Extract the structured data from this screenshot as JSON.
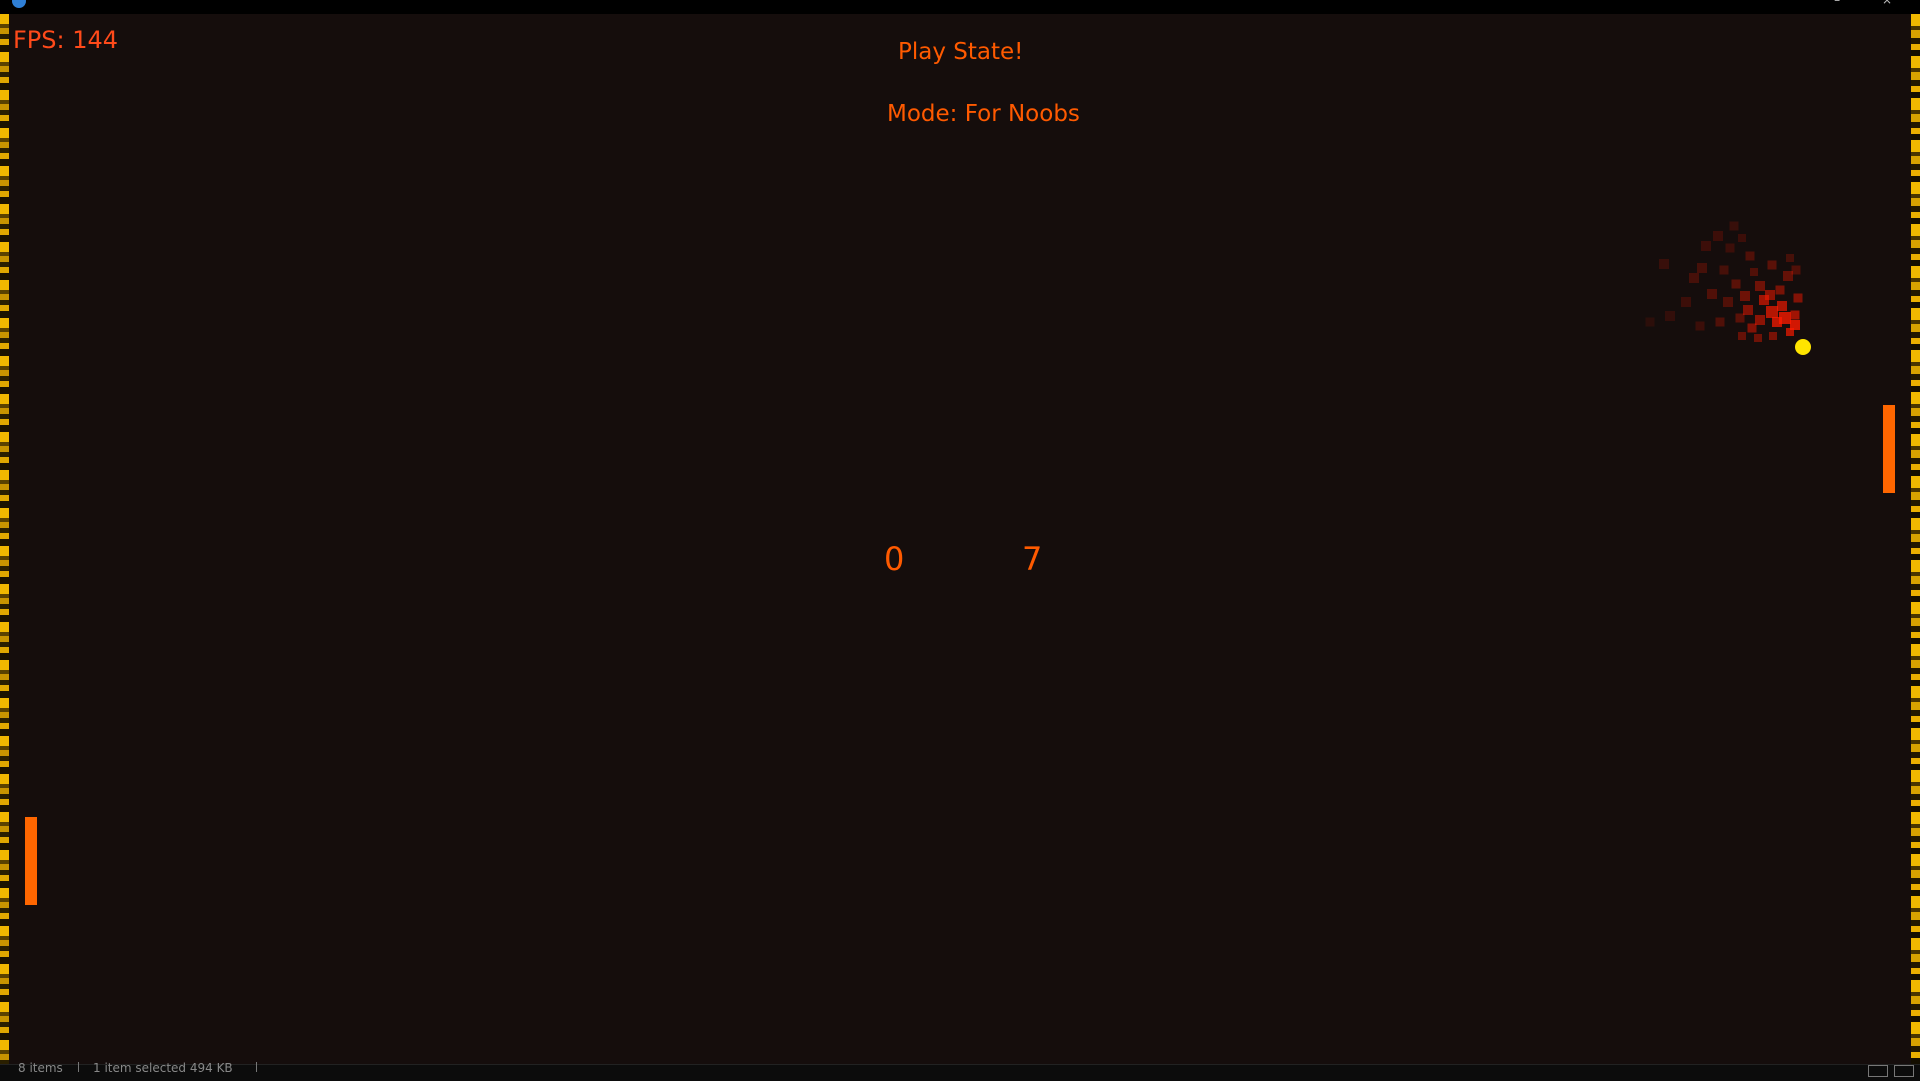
{
  "window": {
    "title": "",
    "controls": [
      "–",
      "×"
    ]
  },
  "hud": {
    "fps": "FPS: 144",
    "state": "Play State!",
    "mode": "Mode: For Noobs"
  },
  "score": {
    "left": "0",
    "right": "7"
  },
  "colors": {
    "background": "#150d0c",
    "hud_text": "#ff5a00",
    "paddle": "#ff6600",
    "ball": "#ffe400",
    "trail": "#ff1a00",
    "wall": "#f0b800"
  },
  "statusbar": {
    "items": "8 items",
    "selected": "1 item selected 494 KB"
  },
  "icons": [
    "app-icon",
    "details-view-icon",
    "tiles-view-icon"
  ]
}
